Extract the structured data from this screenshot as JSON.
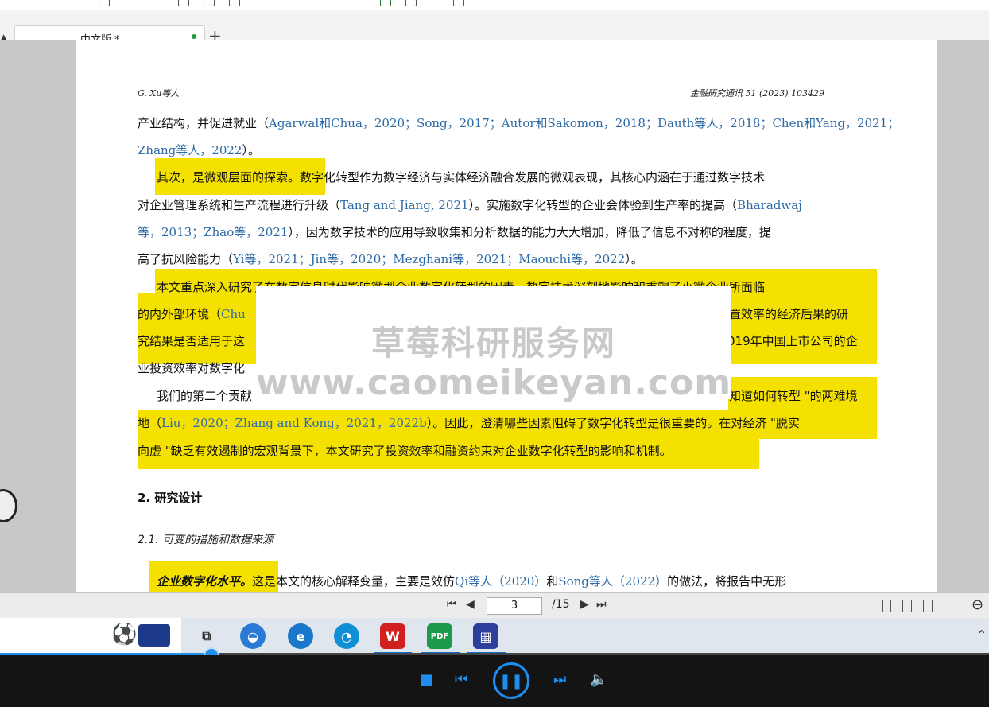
{
  "tabs": {
    "active_label": "中文版 *",
    "add_label": "+"
  },
  "doc": {
    "header_left": "G. Xu等人",
    "header_right": "金融研究通讯 51 (2023) 103429",
    "l1_a": "产业结构，并促进就业（",
    "l1_c": "Agarwal和Chua，2020；Song，2017；Autor和Sakomon，2018；Dauth等人，2018；Chen和Yang，2021；",
    "l2_c": "Zhang等人，2022",
    "l2_b": "）。",
    "l3_hl": "其次，是微观层面的探索。",
    "l3_b": "数字化转型作为数字经济与实体经济融合发展的微观表现，其核心内涵在于通过数字技术",
    "l4_a": "对企业管理系统和生产流程进行升级（",
    "l4_c": "Tang and Jiang, 2021",
    "l4_b": "）。实施数字化转型的企业会体验到生产率的提高（",
    "l4_c2": "Bharadwaj",
    "l5_c": "等，2013；Zhao等，2021",
    "l5_b": "），因为数字技术的应用导致收集和分析数据的能力大大增加，降低了信息不对称的程度，提",
    "l6_a": "高了抗风险能力（",
    "l6_c": "Yi等，2021；Jin等，2020；Mezghani等，2021；Maouchi等，2022",
    "l6_b": "）。",
    "l7": "本文重点深入研究了在数字信息时代影响微型企业数字化转型的因素。数字技术深刻地影响和重塑了小微企业所面临",
    "l8_a": "的内外部环境（",
    "l8_c": "Chu",
    "l8_r": "置效率的经济后果的研",
    "l9_a": "究结果是否适用于这",
    "l9_r": "019年中国上市公司的企",
    "l10_a": "业投资效率对数字化",
    "l11_a": "我们的第二个贡献",
    "l11_r": "知道如何转型 \"的两难境",
    "l12_a": "地（",
    "l12_c": "Liu，2020；Zhang and Kong，2021，2022b",
    "l12_b": "）。因此，澄清哪些因素阻碍了数字化转型是很重要的。在对经济 \"脱实",
    "l13": "向虚 \"缺乏有效遏制的宏观背景下，本文研究了投资效率和融资约束对企业数字化转型的影响和机制。",
    "sec2": "2.  研究设计",
    "sec21": "2.1.  可变的措施和数据来源",
    "l14_hl": "企业数字化水平。",
    "l14_a": "这是本文的核心解释变量，主要是效仿",
    "l14_c": "Qi等人（2020）",
    "l14_b": "和",
    "l14_c2": "Song等人（2022）",
    "l14_d": "的做法，将报告中无形"
  },
  "watermark": {
    "line1": "草莓科研服务网",
    "line2": "www.caomeikeyan.com"
  },
  "nav": {
    "current_page": "3",
    "total_pages": "/15"
  },
  "taskbar": {
    "pdf_label": "PDF",
    "wps_label": "W"
  },
  "player": {
    "progress": 0.21
  }
}
